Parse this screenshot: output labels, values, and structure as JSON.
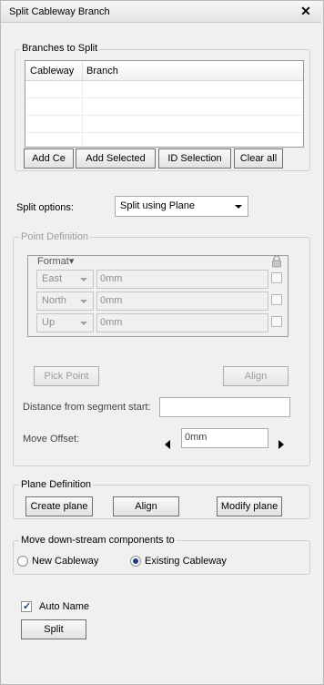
{
  "window": {
    "title": "Split Cableway Branch",
    "close_icon": "close-icon"
  },
  "branches_group": {
    "title": "Branches to Split",
    "columns": [
      "Cableway",
      "Branch"
    ],
    "rows": [
      [
        "",
        ""
      ],
      [
        "",
        ""
      ],
      [
        "",
        ""
      ],
      [
        "",
        ""
      ]
    ],
    "buttons": {
      "add_ce": "Add Ce",
      "add_selected": "Add Selected",
      "id_selection": "ID Selection",
      "clear_all": "Clear all"
    }
  },
  "split_options": {
    "label": "Split options:",
    "selected": "Split using Plane"
  },
  "point_definition": {
    "title": "Point Definition",
    "format_label": "Format▾",
    "lock_icon": "lock-icon",
    "axes": [
      {
        "direction": "East",
        "value": "0mm"
      },
      {
        "direction": "North",
        "value": "0mm"
      },
      {
        "direction": "Up",
        "value": "0mm"
      }
    ],
    "pick_point": "Pick Point",
    "align": "Align",
    "distance_label": "Distance from segment start:",
    "distance_value": "",
    "move_offset_label": "Move Offset:",
    "move_offset_value": "0mm"
  },
  "plane_definition": {
    "title": "Plane Definition",
    "create": "Create plane",
    "align": "Align",
    "modify": "Modify plane"
  },
  "downstream": {
    "title": "Move down-stream components to",
    "options": [
      {
        "label": "New Cableway",
        "selected": false
      },
      {
        "label": "Existing Cableway",
        "selected": true
      }
    ]
  },
  "auto_name": {
    "label": "Auto Name",
    "checked": true
  },
  "split_button": "Split"
}
